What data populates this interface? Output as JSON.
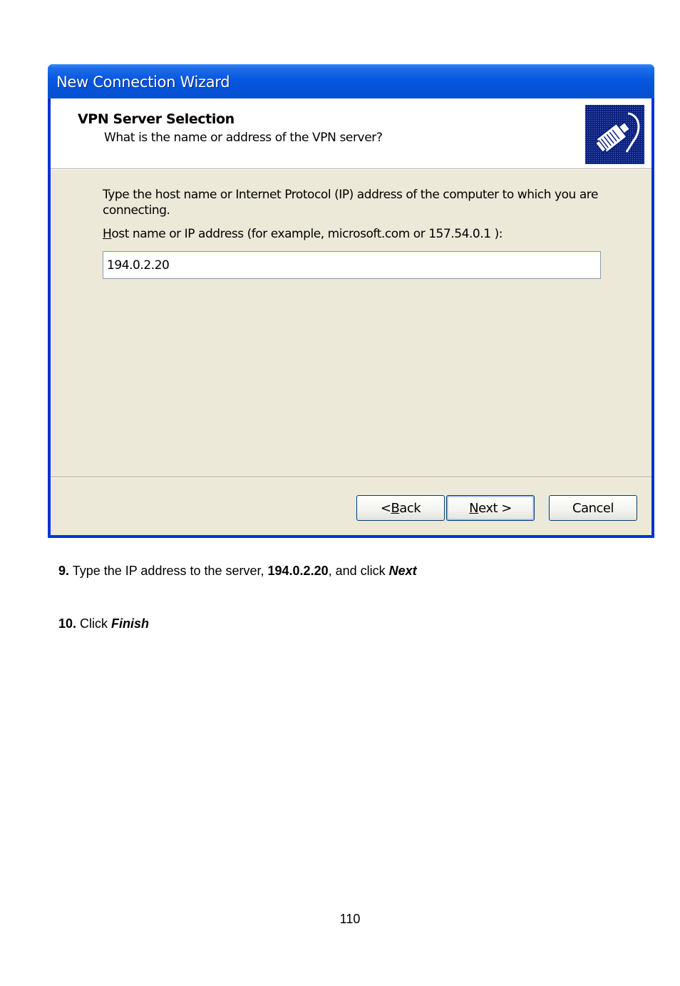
{
  "window": {
    "title": "New Connection Wizard"
  },
  "header": {
    "title": "VPN Server Selection",
    "subtitle": "What is the name or address of the VPN server?",
    "graphic_icon": "network-cable-plug-icon"
  },
  "body": {
    "description": "Type the host name or Internet Protocol (IP) address of the computer to which you are connecting.",
    "field_label_accesskey": "H",
    "field_label_rest": "ost name or IP address (for example, microsoft.com or 157.54.0.1 ):",
    "host_value": "194.0.2.20"
  },
  "buttons": {
    "back_prefix": "< ",
    "back_accesskey": "B",
    "back_rest": "ack",
    "next_accesskey": "N",
    "next_rest": "ext >",
    "cancel": "Cancel"
  },
  "instructions": {
    "step9_number": "9.",
    "step9_text_a": " Type the IP address to the server, ",
    "step9_ip": "194.0.2.20",
    "step9_text_b": ", and click ",
    "step9_action": "Next",
    "step10_number": "10.",
    "step10_text": " Click ",
    "step10_action": "Finish"
  },
  "page_number": "110",
  "colors": {
    "titlebar": "#0453d8",
    "window_frame": "#0831d9",
    "dialog_face": "#ece9d8",
    "graphic_bg": "#0a2180"
  }
}
